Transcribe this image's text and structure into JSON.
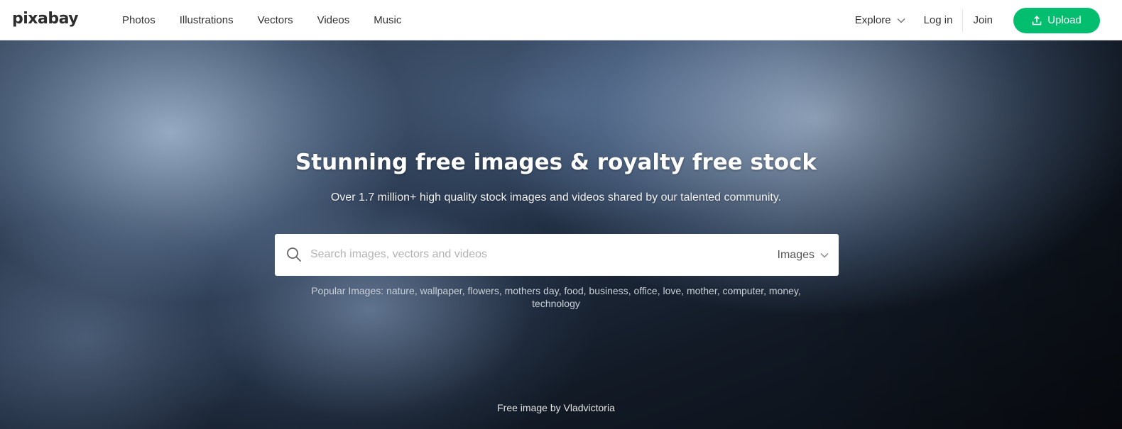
{
  "header": {
    "logo": "pixabay",
    "nav": [
      "Photos",
      "Illustrations",
      "Vectors",
      "Videos",
      "Music"
    ],
    "explore_label": "Explore",
    "login_label": "Log in",
    "join_label": "Join",
    "upload_label": "Upload",
    "accent_color": "#02be6e"
  },
  "hero": {
    "title": "Stunning free images & royalty free stock",
    "subtitle": "Over 1.7 million+ high quality stock images and videos shared by our talented community.",
    "search": {
      "placeholder": "Search images, vectors and videos",
      "value": "",
      "type_selected": "Images"
    },
    "popular_label": "Popular Images:",
    "popular_terms": [
      "nature",
      "wallpaper",
      "flowers",
      "mothers day",
      "food",
      "business",
      "office",
      "love",
      "mother",
      "computer",
      "money",
      "technology"
    ],
    "credit_prefix": "Free image by",
    "credit_author": "Vladvictoria"
  },
  "icons": {
    "explore_chevron": "chevron-down-icon",
    "upload": "upload-icon",
    "search": "search-icon",
    "type_chevron": "chevron-down-icon"
  }
}
